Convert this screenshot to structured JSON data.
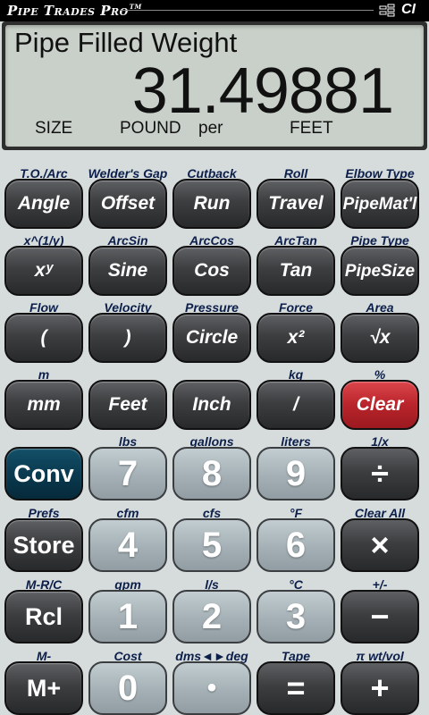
{
  "header": {
    "app_name": "Pipe Trades Pro",
    "trademark": "TM",
    "brand": "CI"
  },
  "display": {
    "title": "Pipe Filled Weight",
    "value": "31.49881",
    "units": [
      "SIZE",
      "POUND",
      "per",
      "FEET"
    ]
  },
  "keys": [
    {
      "sub": "T.O./Arc",
      "label": "Angle"
    },
    {
      "sub": "Welder's Gap",
      "label": "Offset"
    },
    {
      "sub": "Cutback",
      "label": "Run"
    },
    {
      "sub": "Roll",
      "label": "Travel"
    },
    {
      "sub": "Elbow Type",
      "label": "Pipe Mat'l"
    },
    {
      "sub": "x^(1/y)",
      "label": "xʸ"
    },
    {
      "sub": "ArcSin",
      "label": "Sine"
    },
    {
      "sub": "ArcCos",
      "label": "Cos"
    },
    {
      "sub": "ArcTan",
      "label": "Tan"
    },
    {
      "sub": "Pipe Type",
      "label": "Pipe Size"
    },
    {
      "sub": "Flow",
      "label": "("
    },
    {
      "sub": "Velocity",
      "label": ")"
    },
    {
      "sub": "Pressure",
      "label": "Circle"
    },
    {
      "sub": "Force",
      "label": "x²"
    },
    {
      "sub": "Area",
      "label": "√x"
    },
    {
      "sub": "m",
      "label": "mm"
    },
    {
      "sub": "",
      "label": "Feet"
    },
    {
      "sub": "",
      "label": "Inch"
    },
    {
      "sub": "kg",
      "label": "/"
    },
    {
      "sub": "%",
      "label": "Clear"
    },
    {
      "sub": "",
      "label": "Conv"
    },
    {
      "sub": "lbs",
      "label": "7"
    },
    {
      "sub": "gallons",
      "label": "8"
    },
    {
      "sub": "liters",
      "label": "9"
    },
    {
      "sub": "1/x",
      "label": "÷"
    },
    {
      "sub": "Prefs",
      "label": "Store"
    },
    {
      "sub": "cfm",
      "label": "4"
    },
    {
      "sub": "cfs",
      "label": "5"
    },
    {
      "sub": "°F",
      "label": "6"
    },
    {
      "sub": "Clear All",
      "label": "×"
    },
    {
      "sub": "M-R/C",
      "label": "Rcl"
    },
    {
      "sub": "gpm",
      "label": "1"
    },
    {
      "sub": "l/s",
      "label": "2"
    },
    {
      "sub": "°C",
      "label": "3"
    },
    {
      "sub": "+/-",
      "label": "−"
    },
    {
      "sub": "M-",
      "label": "M+"
    },
    {
      "sub": "Cost",
      "label": "0"
    },
    {
      "sub": "dms◄►deg",
      "label": "•"
    },
    {
      "sub": "Tape",
      "label": "="
    },
    {
      "sub": "π wt/vol",
      "label": "+"
    }
  ],
  "colors": {
    "background": "#d6dbdc",
    "lcd": "#c9d0c9",
    "function_key": "#3c3e40",
    "number_key": "#a4b0b5",
    "conv_key": "#0a3a50",
    "clear_key": "#b9242b",
    "sub_label": "#0c1f4a"
  }
}
